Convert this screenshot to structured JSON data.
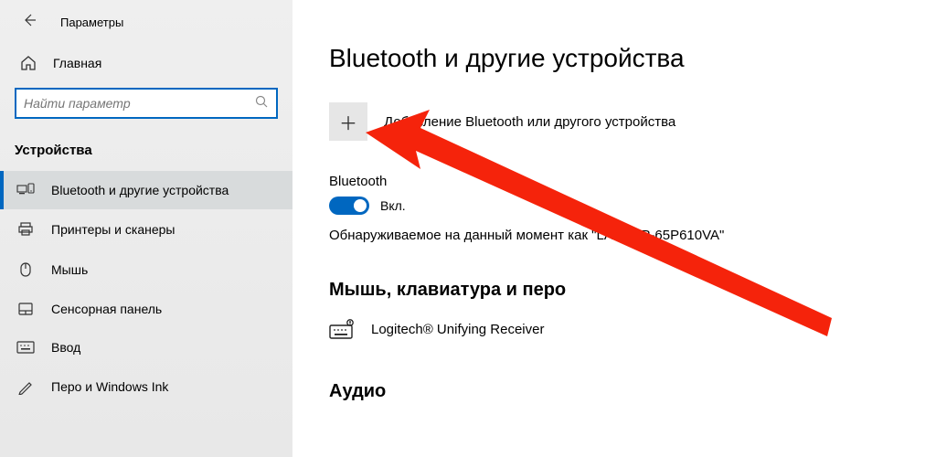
{
  "window": {
    "title": "Параметры"
  },
  "home": {
    "label": "Главная"
  },
  "search": {
    "placeholder": "Найти параметр"
  },
  "category": "Устройства",
  "nav": {
    "items": [
      {
        "label": "Bluetooth и другие устройства"
      },
      {
        "label": "Принтеры и сканеры"
      },
      {
        "label": "Мышь"
      },
      {
        "label": "Сенсорная панель"
      },
      {
        "label": "Ввод"
      },
      {
        "label": "Перо и Windows Ink"
      }
    ]
  },
  "main": {
    "title": "Bluetooth и другие устройства",
    "add_label": "Добавление Bluetooth или другого устройства",
    "bt_heading": "Bluetooth",
    "toggle_state": "Вкл.",
    "discover": "Обнаруживаемое на данный момент как \"LAPTOP-65P610VA\"",
    "section_mouse": "Мышь, клавиатура и перо",
    "device1": "Logitech® Unifying Receiver",
    "section_audio": "Аудио"
  }
}
